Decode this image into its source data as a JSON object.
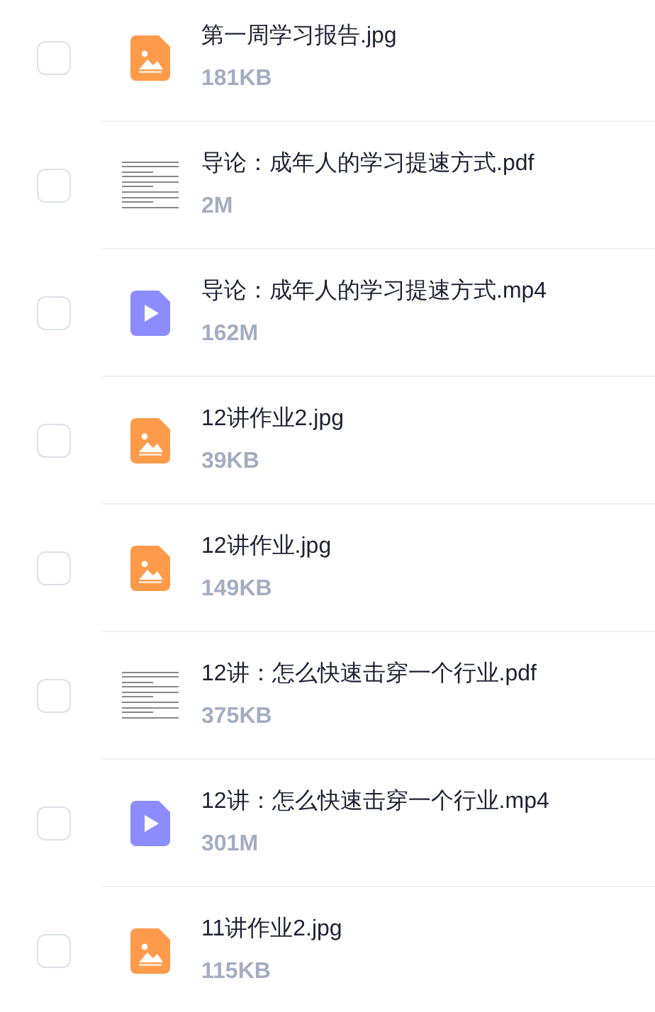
{
  "files": [
    {
      "kind": "image",
      "name": "第一周学习报告.jpg",
      "size": "181KB",
      "checked": false
    },
    {
      "kind": "document",
      "name": "导论：成年人的学习提速方式.pdf",
      "size": "2M",
      "checked": false
    },
    {
      "kind": "video",
      "name": "导论：成年人的学习提速方式.mp4",
      "size": "162M",
      "checked": false
    },
    {
      "kind": "image",
      "name": "12讲作业2.jpg",
      "size": "39KB",
      "checked": false
    },
    {
      "kind": "image",
      "name": "12讲作业.jpg",
      "size": "149KB",
      "checked": false
    },
    {
      "kind": "document",
      "name": "12讲：怎么快速击穿一个行业.pdf",
      "size": "375KB",
      "checked": false
    },
    {
      "kind": "video",
      "name": "12讲：怎么快速击穿一个行业.mp4",
      "size": "301M",
      "checked": false
    },
    {
      "kind": "image",
      "name": "11讲作业2.jpg",
      "size": "115KB",
      "checked": false
    }
  ]
}
